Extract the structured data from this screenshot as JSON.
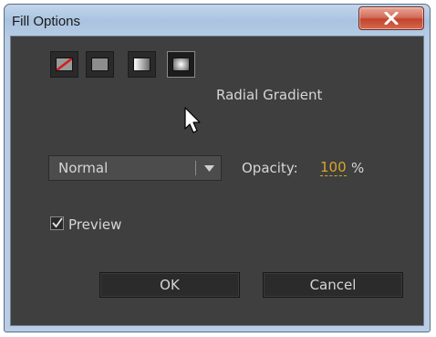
{
  "window": {
    "title": "Fill Options",
    "close_icon": "close-icon"
  },
  "fill_types": {
    "buttons": [
      {
        "name": "no-fill",
        "icon": "no-fill-icon"
      },
      {
        "name": "solid-fill",
        "icon": "solid-fill-icon"
      },
      {
        "name": "linear-gradient",
        "icon": "linear-gradient-icon"
      },
      {
        "name": "radial-gradient",
        "icon": "radial-gradient-icon",
        "selected": true
      }
    ],
    "selected_label": "Radial Gradient"
  },
  "blend": {
    "value": "Normal",
    "arrow_icon": "dropdown-arrow-icon"
  },
  "opacity": {
    "label": "Opacity:",
    "value": "100",
    "unit": "%"
  },
  "preview": {
    "label": "Preview",
    "checked": true
  },
  "buttons": {
    "ok": "OK",
    "cancel": "Cancel"
  },
  "colors": {
    "panel": "#3f3f3f",
    "text": "#d6d6d6",
    "accent": "#d6a72a",
    "close": "#c4432b"
  }
}
